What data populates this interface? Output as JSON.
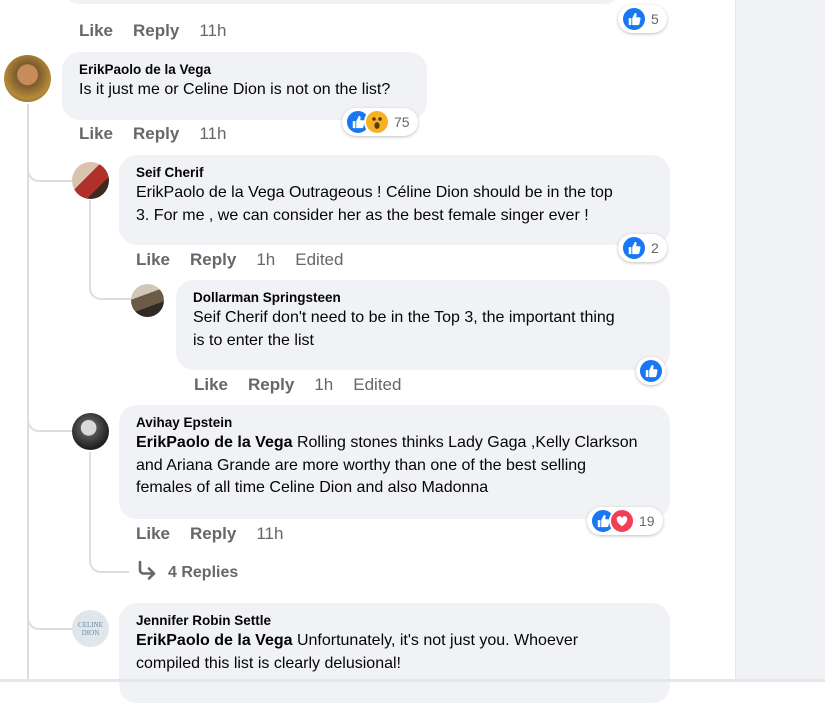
{
  "comments": [
    {
      "id": "top-cut",
      "actions": {
        "like": "Like",
        "reply": "Reply",
        "time": "11h"
      },
      "reaction_count": "5"
    },
    {
      "id": "erik",
      "author": "ErikPaolo de la Vega",
      "text": "Is it just me or Celine Dion is not on the list?",
      "actions": {
        "like": "Like",
        "reply": "Reply",
        "time": "11h"
      },
      "reaction_count": "75"
    },
    {
      "id": "seif",
      "author": "Seif Cherif",
      "text_line1": "ErikPaolo de la Vega Outrageous ! Céline Dion should be in the top",
      "text_line2": "3. For me , we can consider her as the best female singer ever !",
      "actions": {
        "like": "Like",
        "reply": "Reply",
        "time": "1h",
        "edited": "Edited"
      },
      "reaction_count": "2"
    },
    {
      "id": "dollarman",
      "author": "Dollarman Springsteen",
      "text_line1": "Seif Cherif don't need to be in the Top 3, the important thing",
      "text_line2": "is to enter the list",
      "actions": {
        "like": "Like",
        "reply": "Reply",
        "time": "1h",
        "edited": "Edited"
      }
    },
    {
      "id": "avihay",
      "author": "Avihay Epstein",
      "mention": "ErikPaolo de la Vega",
      "text_line1": " Rolling stones thinks Lady Gaga ,Kelly Clarkson",
      "text_line2": "and Ariana Grande are more worthy than one of the best selling",
      "text_line3": "females of all time Celine Dion and also Madonna",
      "actions": {
        "like": "Like",
        "reply": "Reply",
        "time": "11h"
      },
      "reaction_count": "19",
      "replies_label": "4 Replies"
    },
    {
      "id": "jennifer",
      "author": "Jennifer Robin Settle",
      "mention": "ErikPaolo de la Vega",
      "text_line1": " Unfortunately, it's not just you. Whoever",
      "text_line2": "compiled this list is clearly delusional!",
      "avatar_text_1": "CELINE",
      "avatar_text_2": "DION"
    }
  ],
  "colors": {
    "like": "#1877f2",
    "love": "#f33e58",
    "wow": "#f7b125",
    "bubble": "#f0f2f5",
    "meta": "#65676b"
  }
}
